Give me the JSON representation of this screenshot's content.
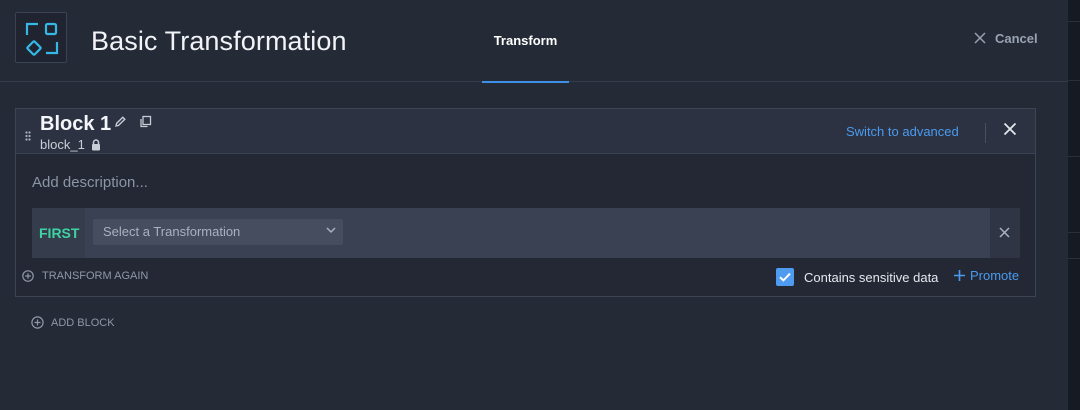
{
  "header": {
    "title": "Basic Transformation",
    "active_tab": "Transform",
    "cancel_label": "Cancel"
  },
  "block": {
    "title": "Block 1",
    "id": "block_1",
    "switch_label": "Switch to advanced",
    "description_placeholder": "Add description...",
    "row": {
      "order_label": "FIRST",
      "select_placeholder": "Select a Transformation"
    },
    "transform_again_label": "TRANSFORM AGAIN",
    "sensitive_label": "Contains sensitive data",
    "sensitive_checked": true,
    "promote_label": "Promote"
  },
  "add_block_label": "ADD BLOCK",
  "colors": {
    "accent": "#4a9bf0",
    "first_label": "#3fd3a4",
    "background": "#242a36"
  }
}
